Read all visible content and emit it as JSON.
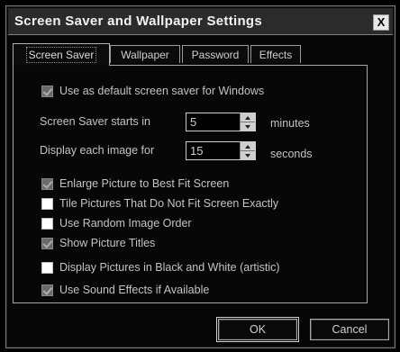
{
  "window": {
    "title": "Screen Saver and Wallpaper Settings",
    "close_label": "X"
  },
  "tabs": [
    {
      "label": "Screen Saver",
      "active": true
    },
    {
      "label": "Wallpaper",
      "active": false
    },
    {
      "label": "Password",
      "active": false
    },
    {
      "label": "Effects",
      "active": false
    }
  ],
  "screen_saver": {
    "use_default": {
      "label": "Use as default screen saver for Windows",
      "checked": true
    },
    "starts_in": {
      "label": "Screen Saver starts in",
      "value": "5",
      "unit": "minutes"
    },
    "display_each": {
      "label": "Display each image for",
      "value": "15",
      "unit": "seconds"
    },
    "options": [
      {
        "label": "Enlarge Picture to Best Fit Screen",
        "checked": true
      },
      {
        "label": "Tile Pictures That Do Not Fit Screen Exactly",
        "checked": false
      },
      {
        "label": "Use Random Image Order",
        "checked": false
      },
      {
        "label": "Show Picture Titles",
        "checked": true
      },
      {
        "label": "Display Pictures in Black and White (artistic)",
        "checked": false
      },
      {
        "label": "Use Sound Effects if Available",
        "checked": true
      }
    ]
  },
  "buttons": {
    "ok": "OK",
    "cancel": "Cancel"
  }
}
